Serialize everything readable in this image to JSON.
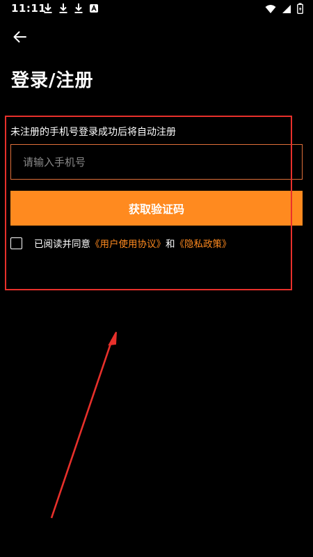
{
  "status_bar": {
    "time": "11:11"
  },
  "page": {
    "title": "登录/注册"
  },
  "form": {
    "hint": "未注册的手机号登录成功后将自动注册",
    "phone_placeholder": "请输入手机号",
    "phone_value": "",
    "get_code_label": "获取验证码",
    "agreement": {
      "prefix": "已阅读并同意",
      "user_agreement": "《用户使用协议》",
      "and": "和",
      "privacy_policy": "《隐私政策》",
      "checked": false
    }
  },
  "colors": {
    "background": "#000000",
    "accent": "#ff8a1f",
    "annotation": "#e8302b"
  }
}
